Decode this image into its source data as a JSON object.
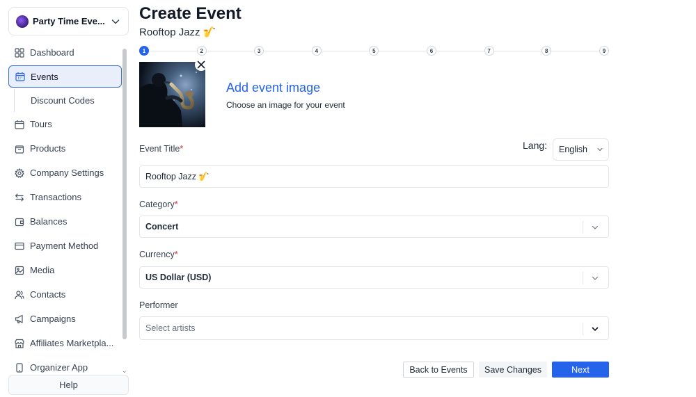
{
  "sidebar": {
    "org_name": "Party Time Eve...",
    "items": [
      {
        "label": "Dashboard",
        "icon": "dashboard-icon"
      },
      {
        "label": "Events",
        "icon": "calendar-icon",
        "active": true
      },
      {
        "label": "Discount Codes",
        "sub": true
      },
      {
        "label": "Tours",
        "icon": "calendar-icon"
      },
      {
        "label": "Products",
        "icon": "bag-icon"
      },
      {
        "label": "Company Settings",
        "icon": "gear-icon"
      },
      {
        "label": "Transactions",
        "icon": "transfer-arrows-icon"
      },
      {
        "label": "Balances",
        "icon": "wallet-icon"
      },
      {
        "label": "Payment Method",
        "icon": "credit-card-icon"
      },
      {
        "label": "Media",
        "icon": "image-icon"
      },
      {
        "label": "Contacts",
        "icon": "users-icon"
      },
      {
        "label": "Campaigns",
        "icon": "megaphone-icon"
      },
      {
        "label": "Affiliates Marketpla...",
        "icon": "store-icon"
      },
      {
        "label": "Organizer App",
        "icon": "phone-icon"
      }
    ],
    "help_label": "Help"
  },
  "header": {
    "title": "Create Event",
    "subtitle": "Rooftop Jazz 🎷"
  },
  "stepper": {
    "steps": [
      "1",
      "2",
      "3",
      "4",
      "5",
      "6",
      "7",
      "8",
      "9"
    ],
    "active_step": 1
  },
  "image_upload": {
    "title": "Add event image",
    "subtitle": "Choose an image for your event"
  },
  "form": {
    "event_title_label": "Event Title",
    "required_mark": "*",
    "lang_label": "Lang:",
    "lang_value": "English",
    "event_title_value": "Rooftop Jazz 🎷",
    "category_label": "Category",
    "category_value": "Concert",
    "currency_label": "Currency",
    "currency_value": "US Dollar (USD)",
    "performer_label": "Performer",
    "performer_placeholder": "Select artists"
  },
  "actions": {
    "back_label": "Back to Events",
    "save_label": "Save Changes",
    "next_label": "Next"
  },
  "colors": {
    "accent": "#2563eb",
    "required": "#dc2626",
    "active_nav_bg": "#e8effb"
  }
}
